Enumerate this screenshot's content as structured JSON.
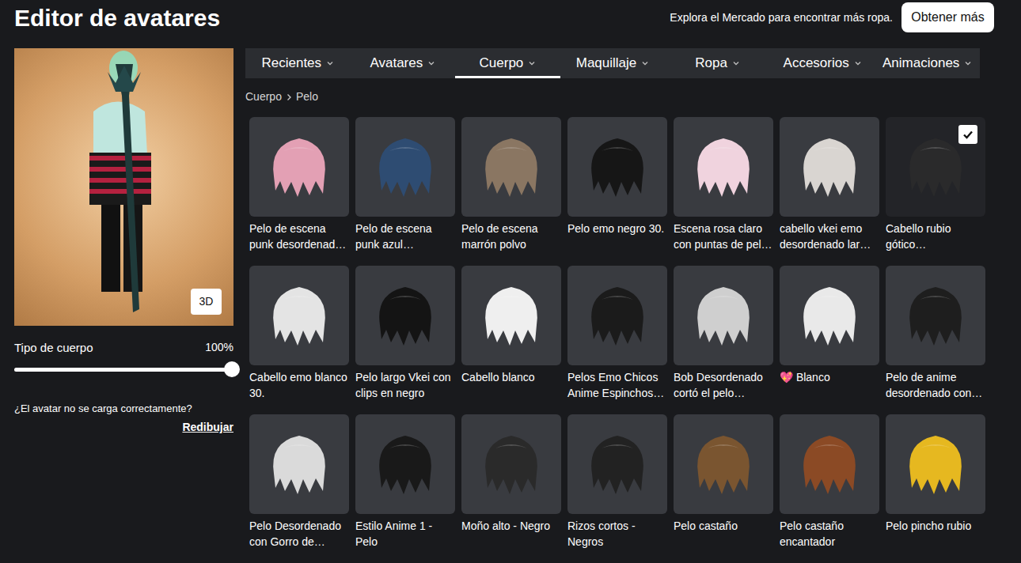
{
  "header": {
    "title": "Editor de avatares",
    "promo": "Explora el Mercado para encontrar más ropa.",
    "get_more_button": "Obtener más"
  },
  "preview": {
    "view_button": "3D",
    "body_type": {
      "label": "Tipo de cuerpo",
      "reading": "100%",
      "level": 1
    },
    "help": "¿El avatar no se carga correctamente?",
    "redraw_link": "Redibujar"
  },
  "tabs": [
    {
      "label": "Recientes",
      "selected": false
    },
    {
      "label": "Avatares",
      "selected": false
    },
    {
      "label": "Cuerpo",
      "selected": true
    },
    {
      "label": "Maquillaje",
      "selected": false
    },
    {
      "label": "Ropa",
      "selected": false
    },
    {
      "label": "Accesorios",
      "selected": false
    },
    {
      "label": "Animaciones",
      "selected": false
    }
  ],
  "breadcrumb": [
    "Cuerpo",
    "Pelo"
  ],
  "items": [
    {
      "name": "Pelo de escena punk desordenad…",
      "color": "#e3a0b4",
      "selected": false
    },
    {
      "name": "Pelo de escena punk azul…",
      "color": "#2e4c72",
      "selected": false
    },
    {
      "name": "Pelo de escena marrón polvo",
      "color": "#8a7662",
      "selected": false
    },
    {
      "name": "Pelo emo negro 30.",
      "color": "#161616",
      "selected": false
    },
    {
      "name": "Escena rosa claro con puntas de pel…",
      "color": "#f0d3de",
      "selected": false
    },
    {
      "name": "cabello vkei emo desordenado lar…",
      "color": "#d9d5d1",
      "selected": false
    },
    {
      "name": "Cabello rubio gótico…",
      "color": "#2a2a2b",
      "selected": true
    },
    {
      "name": "Cabello emo blanco 30.",
      "color": "#e4e4e4",
      "selected": false
    },
    {
      "name": "Pelo largo Vkei con clips en negro",
      "color": "#141414",
      "selected": false
    },
    {
      "name": "Cabello blanco",
      "color": "#efefef",
      "selected": false
    },
    {
      "name": "Pelos Emo Chicos Anime Espinchos…",
      "color": "#1b1b1b",
      "selected": false
    },
    {
      "name": "Bob Desordenado cortó el pelo…",
      "color": "#cfcfcf",
      "selected": false
    },
    {
      "name": "💖 Blanco",
      "color": "#e9e9e9",
      "selected": false
    },
    {
      "name": "Pelo de anime desordenado con…",
      "color": "#1e1e1e",
      "selected": false
    },
    {
      "name": "Pelo Desordenado con Gorro de…",
      "color": "#dadada",
      "selected": false
    },
    {
      "name": "Estilo Anime 1 - Pelo",
      "color": "#191919",
      "selected": false
    },
    {
      "name": "Moño alto - Negro",
      "color": "#2a2a2a",
      "selected": false
    },
    {
      "name": "Rizos cortos - Negros",
      "color": "#222222",
      "selected": false
    },
    {
      "name": "Pelo castaño",
      "color": "#7a5530",
      "selected": false
    },
    {
      "name": "Pelo castaño encantador",
      "color": "#8b4a25",
      "selected": false
    },
    {
      "name": "Pelo pincho rubio",
      "color": "#e6b820",
      "selected": false
    }
  ]
}
